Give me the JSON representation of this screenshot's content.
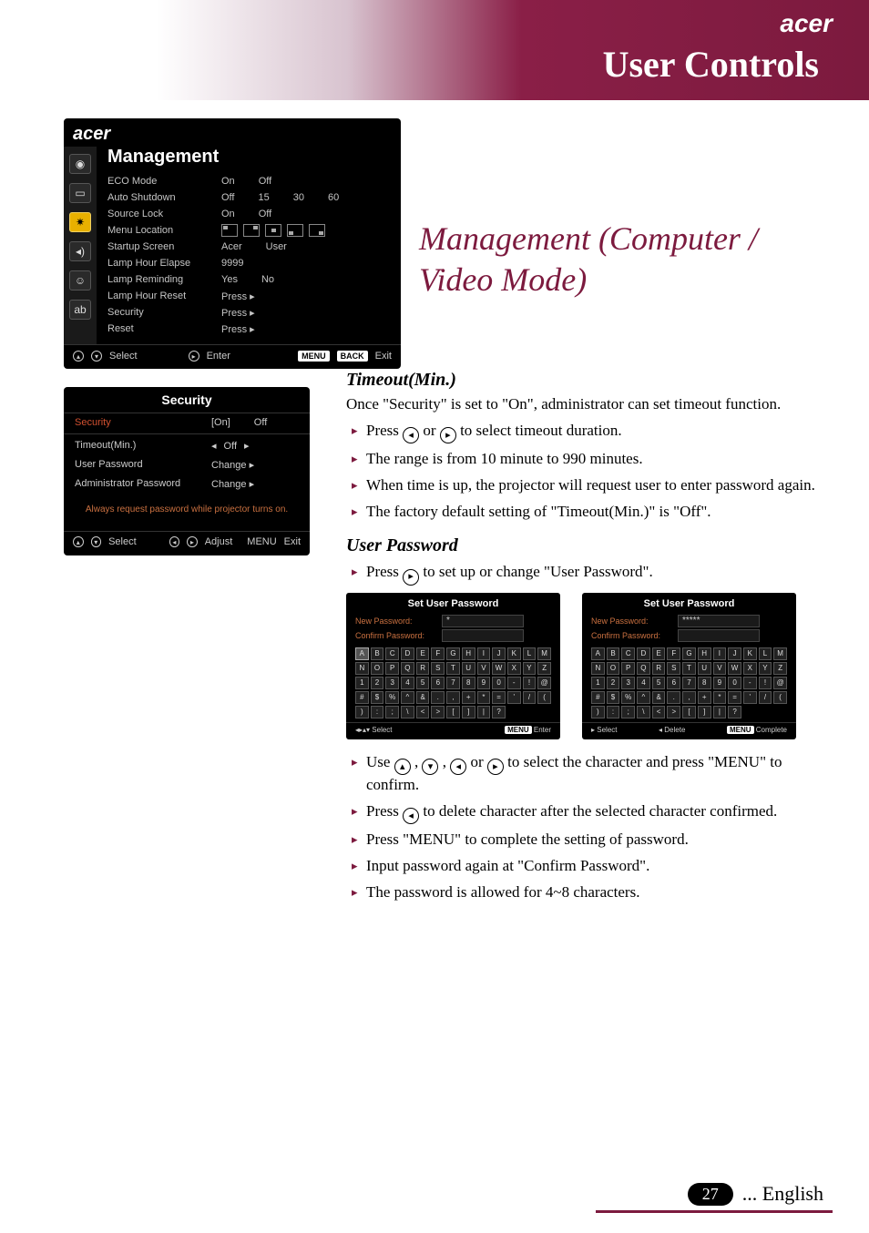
{
  "header": {
    "brand": "acer",
    "title": "User Controls"
  },
  "osd": {
    "brand": "acer",
    "title": "Management",
    "tab_icons": [
      "globe-icon",
      "image-icon",
      "sun-icon",
      "speaker-icon",
      "lamp-icon",
      "language-icon"
    ],
    "rows": [
      {
        "label": "ECO Mode",
        "opts": [
          "On",
          "Off"
        ]
      },
      {
        "label": "Auto Shutdown",
        "opts": [
          "Off",
          "15",
          "30",
          "60"
        ]
      },
      {
        "label": "Source Lock",
        "opts": [
          "On",
          "Off"
        ]
      },
      {
        "label": "Menu Location",
        "opts": []
      },
      {
        "label": "Startup Screen",
        "opts": [
          "Acer",
          "User"
        ]
      },
      {
        "label": "Lamp Hour Elapse",
        "opts": [
          "9999"
        ]
      },
      {
        "label": "Lamp Reminding",
        "opts": [
          "Yes",
          "No"
        ]
      },
      {
        "label": "Lamp Hour Reset",
        "opts": [
          "Press ▸"
        ]
      },
      {
        "label": "Security",
        "opts": [
          "Press ▸"
        ]
      },
      {
        "label": "Reset",
        "opts": [
          "Press ▸"
        ]
      }
    ],
    "footer": {
      "select": "Select",
      "enter": "Enter",
      "menu": "MENU",
      "back": "BACK",
      "exit": "Exit"
    }
  },
  "security_panel": {
    "title": "Security",
    "rows": [
      {
        "label": "Security",
        "value": "[On]",
        "alt": "Off",
        "hl": true
      },
      {
        "label": "Timeout(Min.)",
        "value": "Off"
      },
      {
        "label": "User Password",
        "value": "Change ▸"
      },
      {
        "label": "Administrator Password",
        "value": "Change ▸"
      }
    ],
    "note": "Always request password while projector turns on.",
    "footer": {
      "select": "Select",
      "adjust": "Adjust",
      "menu": "MENU",
      "exit": "Exit"
    }
  },
  "section_heading": "Management (Computer / Video Mode)",
  "timeout": {
    "heading": "Timeout(Min.)",
    "intro": "Once \"Security\" is set to \"On\", administrator can set timeout function.",
    "bullets": [
      "Press ◄ or ► to select timeout duration.",
      "The range is from 10 minute to 990 minutes.",
      "When time is up, the projector will request user to enter password again.",
      "The factory default setting of \"Timeout(Min.)\" is \"Off\"."
    ]
  },
  "user_password": {
    "heading": "User Password",
    "lead_bullet": "Press ► to set up or change \"User Password\".",
    "keypad": {
      "title": "Set User Password",
      "new_label": "New Password:",
      "confirm_label": "Confirm Password:",
      "mask1": "*",
      "mask2": "*****",
      "keys": [
        "A",
        "B",
        "C",
        "D",
        "E",
        "F",
        "G",
        "H",
        "I",
        "J",
        "K",
        "L",
        "M",
        "N",
        "O",
        "P",
        "Q",
        "R",
        "S",
        "T",
        "U",
        "V",
        "W",
        "X",
        "Y",
        "Z",
        "1",
        "2",
        "3",
        "4",
        "5",
        "6",
        "7",
        "8",
        "9",
        "0",
        "-",
        "!",
        "@",
        "#",
        "$",
        "%",
        "^",
        "&",
        ".",
        ",",
        "+",
        "*",
        "=",
        "'",
        "/",
        "(",
        ")",
        ":",
        ";",
        "\\",
        "<",
        ">",
        "[",
        "]",
        "|",
        "?"
      ],
      "foot_left_1": "Select",
      "foot_right_enter": "Enter",
      "foot_mid_delete": "Delete",
      "foot_right_complete": "Complete",
      "menu": "MENU"
    },
    "bullets": [
      "Use ▲ , ▼ , ◄ or ► to select the character and press \"MENU\" to confirm.",
      "Press ◄ to delete character after the selected character confirmed.",
      "Press \"MENU\" to complete the setting of password.",
      "Input password again at \"Confirm Password\".",
      "The password is allowed for 4~8 characters."
    ]
  },
  "footer": {
    "page": "27",
    "lang": "... English"
  }
}
